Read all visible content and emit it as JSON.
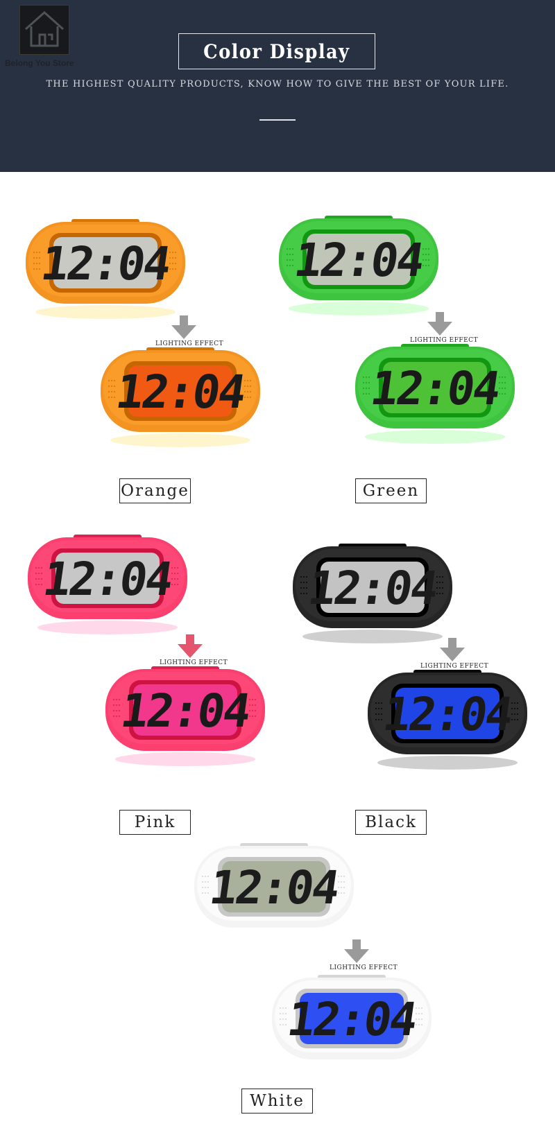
{
  "header": {
    "store_name": "Belong You Store",
    "title": "Color Display",
    "tagline": "THE HIGHEST QUALITY PRODUCTS, KNOW HOW TO GIVE THE BEST OF YOUR LIFE.",
    "background": "#283142"
  },
  "clock_display_text": "12:04",
  "lighting_label": "LIGHTING EFFECT",
  "variants": [
    {
      "label": "Orange",
      "body_color": "#f39321",
      "screen_off": "#c9c9c4",
      "screen_on": "#f05a12",
      "arrow_color": "#9a9a9a"
    },
    {
      "label": "Green",
      "body_color": "#3fc43f",
      "screen_off": "#bfc6b8",
      "screen_on": "#4ec237",
      "arrow_color": "#9a9a9a"
    },
    {
      "label": "Pink",
      "body_color": "#fb3f6f",
      "screen_off": "#c7c7c7",
      "screen_on": "#f2388c",
      "arrow_color": "#e4566e"
    },
    {
      "label": "Black",
      "body_color": "#262626",
      "screen_off": "#c3c3c3",
      "screen_on": "#2045e6",
      "arrow_color": "#9a9a9a"
    },
    {
      "label": "White",
      "body_color": "#f4f4f4",
      "screen_off": "#a9b19d",
      "screen_on": "#2e4ff2",
      "arrow_color": "#9a9a9a"
    }
  ]
}
